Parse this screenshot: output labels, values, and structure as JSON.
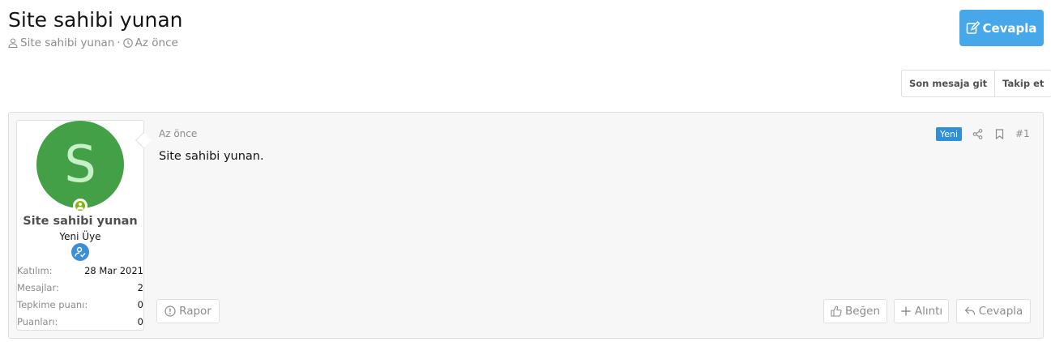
{
  "thread": {
    "title": "Site sahibi yunan",
    "author": "Site sahibi yunan",
    "separator": "·",
    "time": "Az önce"
  },
  "actions": {
    "reply_label": "Cevapla",
    "last_post_label": "Son mesaja git",
    "follow_label": "Takip et"
  },
  "post": {
    "avatar_letter": "S",
    "username": "Site sahibi yunan",
    "user_title": "Yeni Üye",
    "stats": [
      {
        "key": "Katılım:",
        "value": "28 Mar 2021"
      },
      {
        "key": "Mesajlar:",
        "value": "2"
      },
      {
        "key": "Tepkime puanı:",
        "value": "0"
      },
      {
        "key": "Puanları:",
        "value": "0"
      }
    ],
    "date": "Az önce",
    "new_label": "Yeni",
    "number": "#1",
    "content": "Site sahibi yunan.",
    "report_label": "Rapor",
    "like_label": "Beğen",
    "quote_label": "Alıntı",
    "reply_label": "Cevapla"
  },
  "colors": {
    "accent": "#47a7eb",
    "avatar_bg": "#43a047",
    "online": "#7fb900",
    "new_badge": "#2f8fd8"
  },
  "icons": [
    "user-icon",
    "clock-icon",
    "edit-icon",
    "share-icon",
    "bookmark-icon",
    "report-icon",
    "thumbs-up-icon",
    "plus-icon",
    "reply-icon",
    "online-user-icon",
    "member-badge-icon"
  ]
}
